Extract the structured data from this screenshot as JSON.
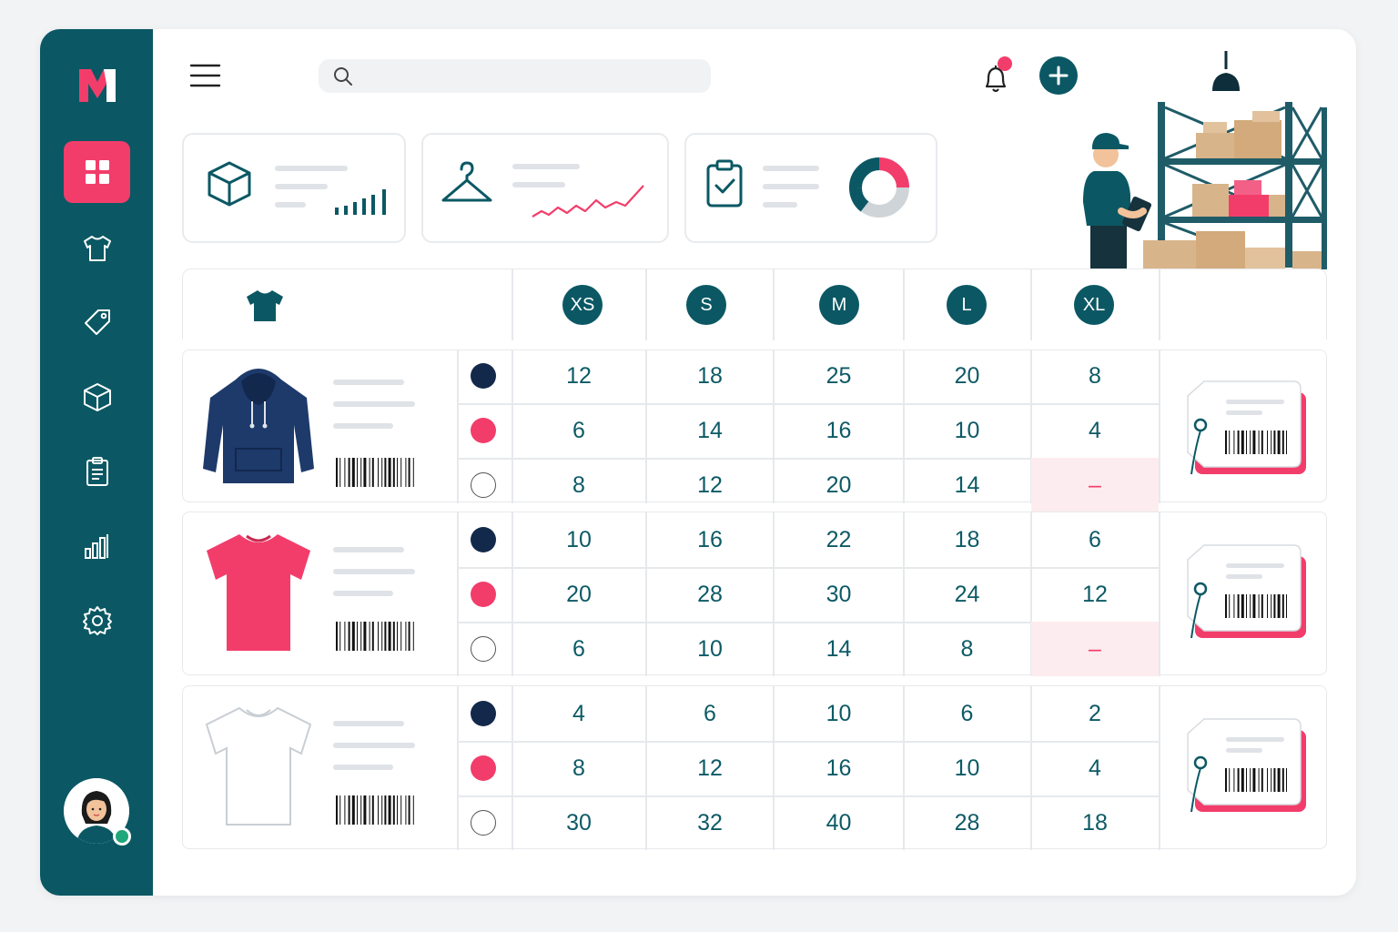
{
  "search": {
    "placeholder": ""
  },
  "notifications": {
    "has_unread": true
  },
  "sidebar": {
    "items": [
      {
        "name": "dashboard",
        "icon": "grid-icon",
        "active": true
      },
      {
        "name": "apparel",
        "icon": "tshirt-icon",
        "active": false
      },
      {
        "name": "tags",
        "icon": "tag-icon",
        "active": false
      },
      {
        "name": "inventory",
        "icon": "box-icon",
        "active": false
      },
      {
        "name": "orders",
        "icon": "clipboard-icon",
        "active": false
      },
      {
        "name": "reports",
        "icon": "bar-chart-icon",
        "active": false
      },
      {
        "name": "settings",
        "icon": "gear-icon",
        "active": false
      }
    ]
  },
  "cards": [
    {
      "icon": "box-icon",
      "widget": "bar-sparkline"
    },
    {
      "icon": "hanger-icon",
      "widget": "line-sparkline"
    },
    {
      "icon": "clipboard-check-icon",
      "widget": "donut"
    }
  ],
  "sizes": [
    "XS",
    "S",
    "M",
    "L",
    "XL"
  ],
  "colors": {
    "navy": "#13294b",
    "pink": "#f23d6b",
    "white": "#ffffff",
    "accent": "#0b5864"
  },
  "products": [
    {
      "item": "hoodie",
      "rows": [
        {
          "color": "navy",
          "qty": [
            "12",
            "18",
            "25",
            "20",
            "8"
          ]
        },
        {
          "color": "pink",
          "qty": [
            "6",
            "14",
            "16",
            "10",
            "4"
          ]
        },
        {
          "color": "white",
          "qty": [
            "8",
            "12",
            "20",
            "14",
            "–"
          ]
        }
      ]
    },
    {
      "item": "t-shirt-pink",
      "rows": [
        {
          "color": "navy",
          "qty": [
            "10",
            "16",
            "22",
            "18",
            "6"
          ]
        },
        {
          "color": "pink",
          "qty": [
            "20",
            "28",
            "30",
            "24",
            "12"
          ]
        },
        {
          "color": "white",
          "qty": [
            "6",
            "10",
            "14",
            "8",
            "–"
          ]
        }
      ]
    },
    {
      "item": "t-shirt-white",
      "rows": [
        {
          "color": "navy",
          "qty": [
            "4",
            "6",
            "10",
            "6",
            "2"
          ]
        },
        {
          "color": "pink",
          "qty": [
            "8",
            "12",
            "16",
            "10",
            "4"
          ]
        },
        {
          "color": "white",
          "qty": [
            "30",
            "32",
            "40",
            "28",
            "18"
          ]
        }
      ]
    }
  ]
}
